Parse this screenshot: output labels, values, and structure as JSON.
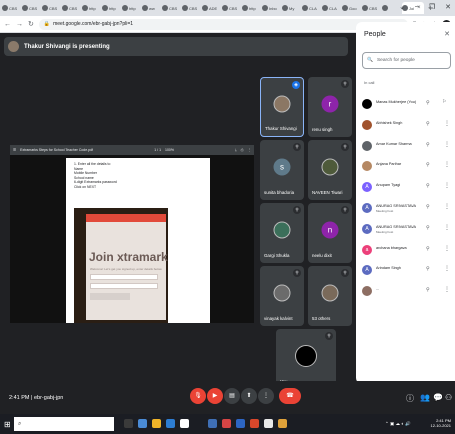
{
  "browser": {
    "tabs": [
      "CBS",
      "CBS",
      "CBS",
      "CBS",
      "http",
      "http",
      "http",
      "ww",
      "CBS",
      "CBS",
      "ADE",
      "CBS",
      "http",
      "Inbo",
      "My",
      "CLA",
      "CLA",
      "Goo",
      "CBS",
      "",
      "Joi"
    ],
    "new_tab": "+",
    "window_controls": [
      "⌄",
      "–",
      "❐",
      "✕"
    ],
    "url": "meet.google.com/ebr-gabj-jpn?pli=1"
  },
  "meet": {
    "presenting_text": "Thakur Shivangi is presenting",
    "clock": "2:41 PM",
    "meeting_code": "ebr-gabj-jpn",
    "shared_screen": {
      "viewer_title": "Extramarks Steps for School Teacher Code.pdf",
      "page": "1 / 1",
      "zoom": "100%",
      "doc_lines": [
        "1. Enter all the details to",
        "Name",
        "Mobile Number",
        "School name",
        "6-digit Extramarks password",
        "Click on NEXT"
      ],
      "photo_text": "Join  xtramarks",
      "photo_sub": "Welcome! Let's get you signed up, enter details below."
    },
    "tiles": [
      {
        "name": "Thakur Shivangi",
        "initial": "",
        "color": "#8b7764"
      },
      {
        "name": "renu singh",
        "initial": "r",
        "color": "#8e24aa"
      },
      {
        "name": "sunita bhadoria",
        "initial": "s",
        "color": "#5f7a8a"
      },
      {
        "name": "NAVEEN Tiwari",
        "initial": "",
        "color": "#4e5a3a"
      },
      {
        "name": "Gargi Shukla",
        "initial": "",
        "color": "#3b6f5a"
      },
      {
        "name": "neelu dixit",
        "initial": "n",
        "color": "#8e24aa"
      },
      {
        "name": "vinayak kalvint",
        "initial": "",
        "color": "#6b6b6b"
      },
      {
        "name": "53 others",
        "initial": "",
        "color": "#7a6a5a"
      },
      {
        "name": "You",
        "initial": "",
        "color": "#000000"
      }
    ]
  },
  "people": {
    "title": "People",
    "search_placeholder": "Search for people",
    "in_call": "In call",
    "list": [
      {
        "name": "Manas Mukherjee (You)",
        "role": "",
        "initial": "",
        "color": "#000000"
      },
      {
        "name": "Abhishek Singh",
        "role": "",
        "initial": "",
        "color": "#a0522d"
      },
      {
        "name": "Amar Kumar Sharma",
        "role": "",
        "initial": "",
        "color": "#5f6368"
      },
      {
        "name": "Anjana Parihar",
        "role": "",
        "initial": "",
        "color": "#b58863"
      },
      {
        "name": "Anupam Tyagi",
        "role": "",
        "initial": "A",
        "color": "#7b61ff"
      },
      {
        "name": "ANURAG SRIVASTAVA",
        "role": "Meeting host",
        "initial": "A",
        "color": "#5c6bc0"
      },
      {
        "name": "ANURAG SRIVASTAVA",
        "role": "Meeting host",
        "initial": "A",
        "color": "#5c6bc0"
      },
      {
        "name": "archana bhargava",
        "role": "",
        "initial": "a",
        "color": "#ec407a"
      },
      {
        "name": "Arindam Singh",
        "role": "",
        "initial": "A",
        "color": "#5c6bc0"
      },
      {
        "name": "...",
        "role": "",
        "initial": "",
        "color": "#8d6e63"
      }
    ]
  },
  "taskbar": {
    "search_placeholder": "",
    "time": "2:41 PM",
    "date": "12-10-2021"
  },
  "colors": {
    "meet_bg": "#202124",
    "tile_bg": "#3c4043",
    "danger": "#ea4335",
    "accent": "#1a73e8"
  }
}
